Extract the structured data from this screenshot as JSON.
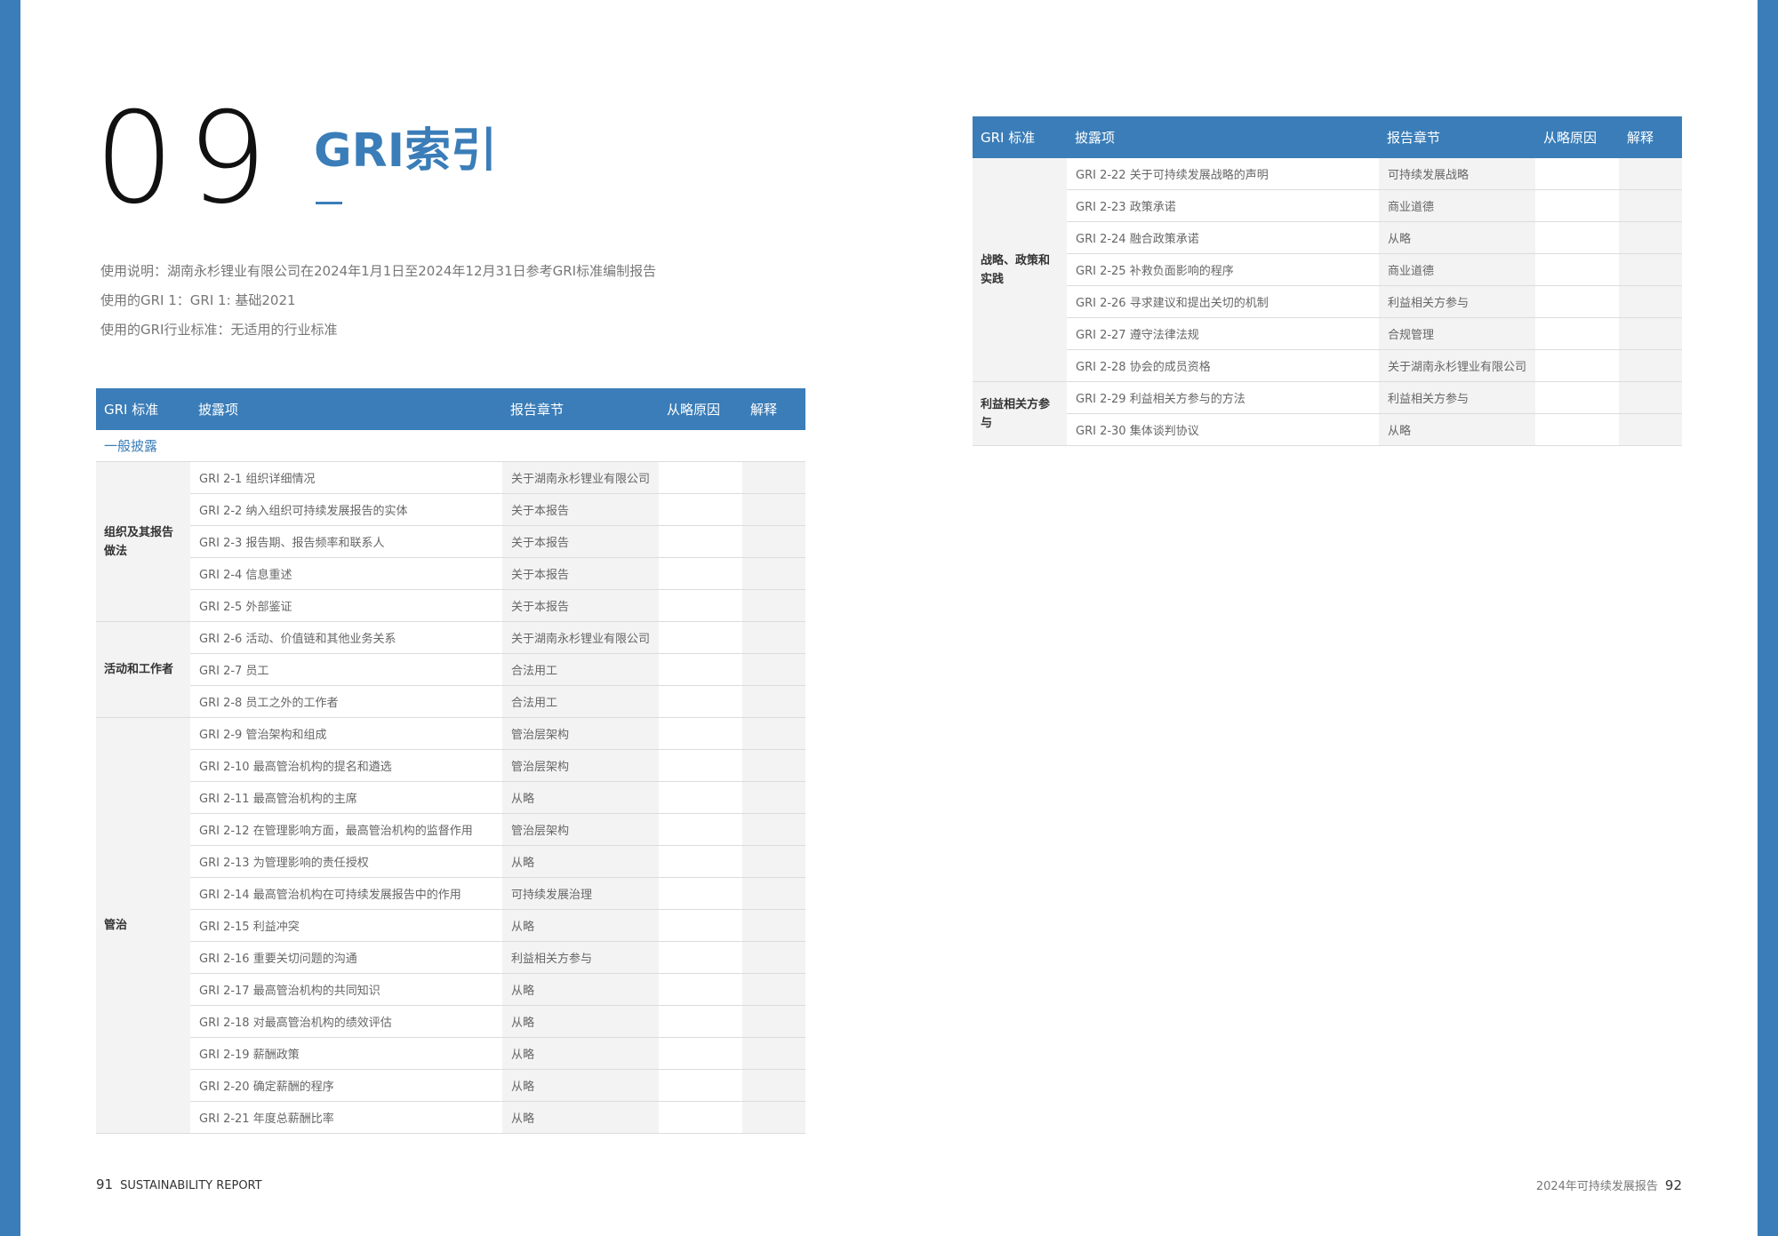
{
  "chapter": {
    "number": "09",
    "title": "GRI索引"
  },
  "notes": [
    "使用说明：湖南永杉锂业有限公司在2024年1月1日至2024年12月31日参考GRI标准编制报告",
    "使用的GRI 1：GRI 1: 基础2021",
    "使用的GRI行业标准：无适用的行业标准"
  ],
  "table_headers": {
    "standard": "GRI 标准",
    "disclosure": "披露项",
    "section": "报告章节",
    "omission": "从略原因",
    "explanation": "解释"
  },
  "general_disclosure_label": "一般披露",
  "left_groups": [
    {
      "name": "组织及其报告做法",
      "rows": [
        {
          "disclosure": "GRI 2-1 组织详细情况",
          "section": "关于湖南永杉锂业有限公司"
        },
        {
          "disclosure": "GRI 2-2 纳入组织可持续发展报告的实体",
          "section": "关于本报告"
        },
        {
          "disclosure": "GRI 2-3 报告期、报告频率和联系人",
          "section": "关于本报告"
        },
        {
          "disclosure": "GRI 2-4 信息重述",
          "section": "关于本报告"
        },
        {
          "disclosure": "GRI 2-5 外部鉴证",
          "section": "关于本报告"
        }
      ]
    },
    {
      "name": "活动和工作者",
      "rows": [
        {
          "disclosure": "GRI 2-6 活动、价值链和其他业务关系",
          "section": "关于湖南永杉锂业有限公司"
        },
        {
          "disclosure": "GRI 2-7 员工",
          "section": "合法用工"
        },
        {
          "disclosure": "GRI 2-8 员工之外的工作者",
          "section": "合法用工"
        }
      ]
    },
    {
      "name": "管治",
      "rows": [
        {
          "disclosure": "GRI 2-9 管治架构和组成",
          "section": "管治层架构"
        },
        {
          "disclosure": "GRI 2-10 最高管治机构的提名和遴选",
          "section": "管治层架构"
        },
        {
          "disclosure": "GRI 2-11 最高管治机构的主席",
          "section": "从略"
        },
        {
          "disclosure": "GRI 2-12 在管理影响方面，最高管治机构的监督作用",
          "section": "管治层架构"
        },
        {
          "disclosure": "GRI 2-13 为管理影响的责任授权",
          "section": "从略"
        },
        {
          "disclosure": "GRI 2-14 最高管治机构在可持续发展报告中的作用",
          "section": "可持续发展治理"
        },
        {
          "disclosure": "GRI 2-15 利益冲突",
          "section": "从略"
        },
        {
          "disclosure": "GRI 2-16 重要关切问题的沟通",
          "section": "利益相关方参与"
        },
        {
          "disclosure": "GRI 2-17 最高管治机构的共同知识",
          "section": "从略"
        },
        {
          "disclosure": "GRI 2-18 对最高管治机构的绩效评估",
          "section": "从略"
        },
        {
          "disclosure": "GRI 2-19 薪酬政策",
          "section": "从略"
        },
        {
          "disclosure": "GRI 2-20 确定薪酬的程序",
          "section": "从略"
        },
        {
          "disclosure": "GRI 2-21 年度总薪酬比率",
          "section": "从略"
        }
      ]
    }
  ],
  "right_groups": [
    {
      "name": "战略、政策和实践",
      "rows": [
        {
          "disclosure": "GRI 2-22 关于可持续发展战略的声明",
          "section": "可持续发展战略"
        },
        {
          "disclosure": "GRI 2-23 政策承诺",
          "section": "商业道德"
        },
        {
          "disclosure": "GRI 2-24 融合政策承诺",
          "section": "从略"
        },
        {
          "disclosure": "GRI 2-25 补救负面影响的程序",
          "section": "商业道德"
        },
        {
          "disclosure": "GRI 2-26 寻求建议和提出关切的机制",
          "section": "利益相关方参与"
        },
        {
          "disclosure": "GRI 2-27 遵守法律法规",
          "section": "合规管理"
        },
        {
          "disclosure": "GRI 2-28 协会的成员资格",
          "section": "关于湖南永杉锂业有限公司"
        }
      ]
    },
    {
      "name": "利益相关方参与",
      "rows": [
        {
          "disclosure": "GRI 2-29 利益相关方参与的方法",
          "section": "利益相关方参与"
        },
        {
          "disclosure": "GRI 2-30 集体谈判协议",
          "section": "从略"
        }
      ]
    }
  ],
  "footer": {
    "left_page": "91",
    "left_text": "SUSTAINABILITY REPORT",
    "right_text": "2024年可持续发展报告",
    "right_page": "92"
  }
}
